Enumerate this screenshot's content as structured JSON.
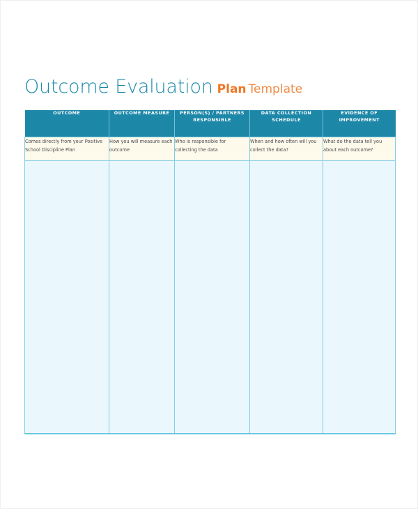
{
  "document": {
    "title_main": "Outcome Evaluation",
    "title_accent_bold": "Plan",
    "title_accent_light": "Template"
  },
  "colors": {
    "title_teal": "#1b8aa8",
    "accent_orange_bold": "#ef7726",
    "accent_orange_light": "#f08b44",
    "header_band": "#1d87a8",
    "example_row_background": "#fdfaec",
    "blank_row_background": "#eaf7fc",
    "grid_line": "#7fcde3",
    "page_background": "#ffffff"
  },
  "table": {
    "columns": [
      {
        "header": "OUTCOME",
        "example": "Comes directly from your Positive School Discipline Plan"
      },
      {
        "header": "OUTCOME MEASURE",
        "example": "How you will measure each outcome"
      },
      {
        "header": "PERSON(S) / PARTNERS RESPONSIBLE",
        "example": "Who is responsible for collecting the data"
      },
      {
        "header": "DATA COLLECTION SCHEDULE",
        "example": "When and how often will you collect the data?"
      },
      {
        "header": "EVIDENCE OF IMPROVEMENT",
        "example": "What do the data tell you about each outcome?"
      }
    ],
    "blank_rows": 1
  }
}
